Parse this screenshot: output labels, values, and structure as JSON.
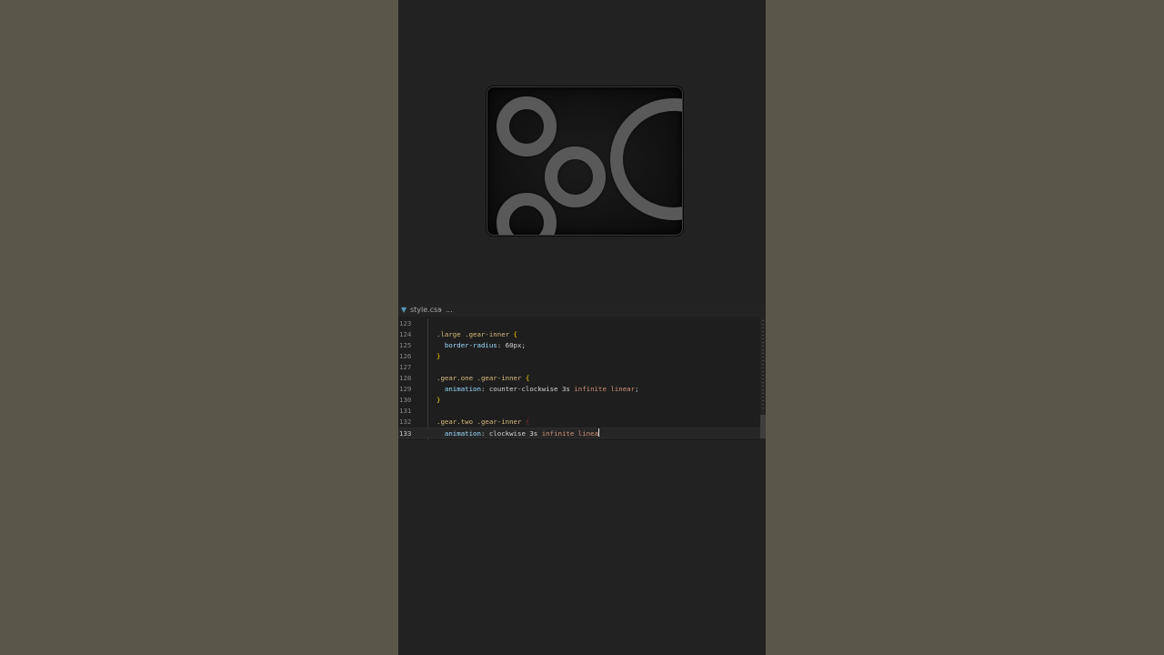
{
  "editor": {
    "breadcrumb": {
      "file_name": "style.css",
      "separator": "›",
      "more": "..."
    },
    "lines": [
      {
        "number": "123",
        "tokens": []
      },
      {
        "number": "124",
        "tokens": [
          {
            "cls": "sel",
            "text": ".large .gear-inner "
          },
          {
            "cls": "brace",
            "text": "{"
          }
        ]
      },
      {
        "number": "125",
        "tokens": [
          {
            "cls": "prop",
            "text": "  border-radius"
          },
          {
            "cls": "punc",
            "text": ": "
          },
          {
            "cls": "val",
            "text": "60px"
          },
          {
            "cls": "punc",
            "text": ";"
          }
        ]
      },
      {
        "number": "126",
        "tokens": [
          {
            "cls": "brace",
            "text": "}"
          }
        ]
      },
      {
        "number": "127",
        "tokens": []
      },
      {
        "number": "128",
        "tokens": [
          {
            "cls": "sel",
            "text": ".gear.one .gear-inner "
          },
          {
            "cls": "brace",
            "text": "{"
          }
        ]
      },
      {
        "number": "129",
        "tokens": [
          {
            "cls": "prop",
            "text": "  animation"
          },
          {
            "cls": "punc",
            "text": ": "
          },
          {
            "cls": "val",
            "text": "counter-clockwise 3s "
          },
          {
            "cls": "kw",
            "text": "infinite linear"
          },
          {
            "cls": "punc",
            "text": ";"
          }
        ]
      },
      {
        "number": "130",
        "tokens": [
          {
            "cls": "brace",
            "text": "}"
          }
        ]
      },
      {
        "number": "131",
        "tokens": []
      },
      {
        "number": "132",
        "tokens": [
          {
            "cls": "sel",
            "text": ".gear.two .gear-inner "
          },
          {
            "cls": "brace-dim",
            "text": "{"
          }
        ]
      },
      {
        "number": "133",
        "active": true,
        "tokens": [
          {
            "cls": "prop",
            "text": "  animation"
          },
          {
            "cls": "punc",
            "text": ": "
          },
          {
            "cls": "val",
            "text": "clockwise 3s "
          },
          {
            "cls": "kw",
            "text": "infinite linea"
          }
        ]
      }
    ]
  },
  "colors": {
    "background_outer": "#5a5749",
    "phone_background": "#222222",
    "gear_color": "#595959",
    "selector": "#d7ba7d",
    "property": "#9cdcfe",
    "keyword_value": "#ce9178"
  },
  "icons": {
    "file_icon": "css-file-icon"
  }
}
